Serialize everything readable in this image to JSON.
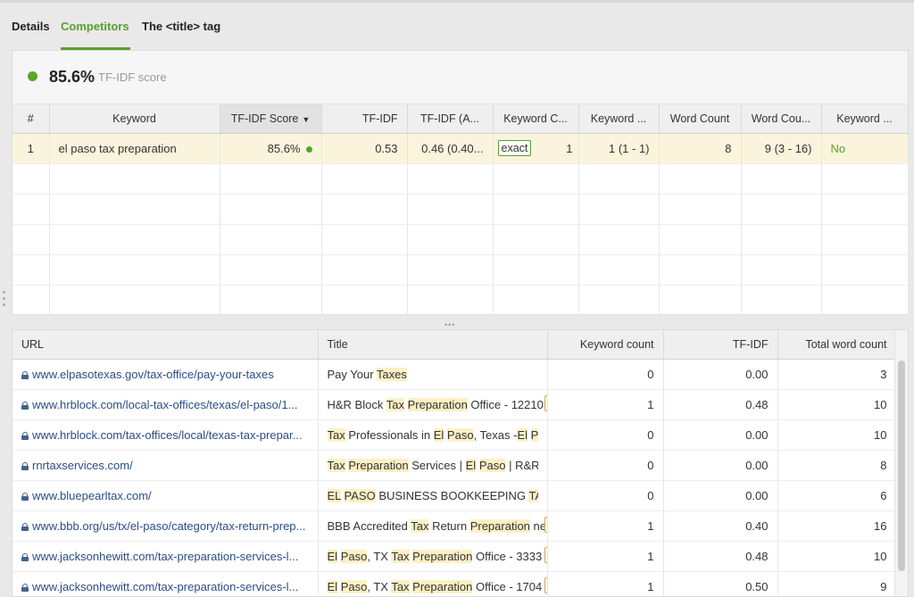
{
  "tabs": [
    {
      "label": "Details",
      "active": false
    },
    {
      "label": "Competitors",
      "active": true
    },
    {
      "label": "The <title> tag",
      "active": false
    }
  ],
  "score": {
    "value": "85.6%",
    "label": "TF-IDF score",
    "status_color": "#5aa52a"
  },
  "keywords_table": {
    "columns": [
      "#",
      "Keyword",
      "TF-IDF Score",
      "TF-IDF",
      "TF-IDF (A...",
      "Keyword C...",
      "Keyword ...",
      "Word Count",
      "Word Cou...",
      "Keyword ..."
    ],
    "sorted_column": "TF-IDF Score",
    "rows": [
      {
        "num": "1",
        "keyword": "el paso tax preparation",
        "score": "85.6%",
        "tfidf": "0.53",
        "tfidf_avg": "0.46 (0.40...",
        "match": "exact",
        "kw_count": "1",
        "kw_range": "1 (1 - 1)",
        "word_count": "8",
        "word_range": "9 (3 - 16)",
        "kw_flag": "No"
      }
    ]
  },
  "url_table": {
    "columns": [
      "URL",
      "Title",
      "Keyword count",
      "TF-IDF",
      "Total word count"
    ],
    "rows": [
      {
        "url": "www.elpasotexas.gov/tax-office/pay-your-taxes",
        "title": [
          {
            "t": "Pay Your "
          },
          {
            "t": "Taxes",
            "h": true
          }
        ],
        "badge": "",
        "kw": "0",
        "tfidf": "0.00",
        "words": "3"
      },
      {
        "url": "www.hrblock.com/local-tax-offices/texas/el-paso/1...",
        "title": [
          {
            "t": "H&R Block "
          },
          {
            "t": "Tax",
            "h": true
          },
          {
            "t": " "
          },
          {
            "t": "Preparation",
            "h": true
          },
          {
            "t": " Office - 12210 "
          }
        ],
        "badge": "broad",
        "kw": "1",
        "tfidf": "0.48",
        "words": "10"
      },
      {
        "url": "www.hrblock.com/tax-offices/local/texas-tax-prepar...",
        "title": [
          {
            "t": "Tax",
            "h": true
          },
          {
            "t": " Professionals in "
          },
          {
            "t": "El",
            "h": true
          },
          {
            "t": " "
          },
          {
            "t": "Paso",
            "h": true
          },
          {
            "t": ", Texas -"
          },
          {
            "t": "El",
            "h": true
          },
          {
            "t": " "
          },
          {
            "t": "Paso",
            "h": true
          }
        ],
        "badge": "",
        "kw": "0",
        "tfidf": "0.00",
        "words": "10"
      },
      {
        "url": "rnrtaxservices.com/",
        "title": [
          {
            "t": "Tax",
            "h": true
          },
          {
            "t": " "
          },
          {
            "t": "Preparation",
            "h": true
          },
          {
            "t": " Services | "
          },
          {
            "t": "El",
            "h": true
          },
          {
            "t": " "
          },
          {
            "t": "Paso",
            "h": true
          },
          {
            "t": " | R&R T"
          }
        ],
        "badge": "",
        "kw": "0",
        "tfidf": "0.00",
        "words": "8"
      },
      {
        "url": "www.bluepearltax.com/",
        "title": [
          {
            "t": "EL",
            "h": true
          },
          {
            "t": " "
          },
          {
            "t": "PASO",
            "h": true
          },
          {
            "t": " BUSINESS BOOKKEEPING "
          },
          {
            "t": "TA",
            "h": true
          }
        ],
        "badge": "",
        "kw": "0",
        "tfidf": "0.00",
        "words": "6"
      },
      {
        "url": "www.bbb.org/us/tx/el-paso/category/tax-return-prep...",
        "title": [
          {
            "t": "BBB Accredited "
          },
          {
            "t": "Tax",
            "h": true
          },
          {
            "t": " Return "
          },
          {
            "t": "Preparation",
            "h": true
          },
          {
            "t": " ne"
          }
        ],
        "badge": "broad",
        "kw": "1",
        "tfidf": "0.40",
        "words": "16"
      },
      {
        "url": "www.jacksonhewitt.com/tax-preparation-services-l...",
        "title": [
          {
            "t": "El",
            "h": true
          },
          {
            "t": " "
          },
          {
            "t": "Paso",
            "h": true
          },
          {
            "t": ", TX "
          },
          {
            "t": "Tax",
            "h": true
          },
          {
            "t": " "
          },
          {
            "t": "Preparation",
            "h": true
          },
          {
            "t": " Office - 3333 "
          }
        ],
        "badge": "broad",
        "kw": "1",
        "tfidf": "0.48",
        "words": "10"
      },
      {
        "url": "www.jacksonhewitt.com/tax-preparation-services-l...",
        "title": [
          {
            "t": "El",
            "h": true
          },
          {
            "t": " "
          },
          {
            "t": "Paso",
            "h": true
          },
          {
            "t": ", TX "
          },
          {
            "t": "Tax",
            "h": true
          },
          {
            "t": " "
          },
          {
            "t": "Preparation",
            "h": true
          },
          {
            "t": " Office - 1704 "
          }
        ],
        "badge": "broad",
        "kw": "1",
        "tfidf": "0.50",
        "words": "9"
      }
    ]
  },
  "icons": {
    "lock": "lock-icon",
    "status": "green-dot-icon"
  },
  "colors": {
    "accent": "#5a9e2f",
    "link": "#2b4d86",
    "highlight": "#fdf0c4",
    "broad_badge": "#d1a64a",
    "selected_row": "#fbf4dc"
  }
}
